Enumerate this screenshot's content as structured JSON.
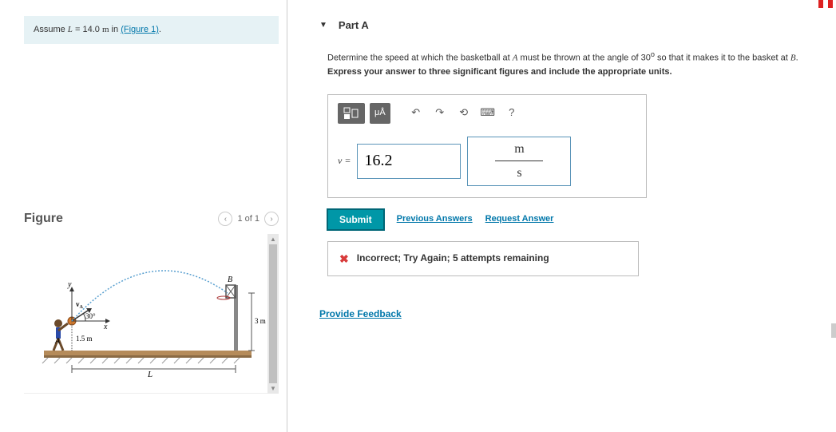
{
  "left": {
    "assume_prefix": "Assume ",
    "assume_var": "L",
    "assume_eq": " = 14.0 ",
    "assume_unit": "m",
    "assume_in": " in ",
    "figure_link": "(Figure 1)",
    "assume_period": "."
  },
  "figure": {
    "title": "Figure",
    "page_info": "1 of 1",
    "labels": {
      "angle": "30°",
      "x": "x",
      "y": "y",
      "height_left": "1.5 m",
      "height_right": "3 m",
      "L": "L",
      "A": "A",
      "B": "B",
      "vA": "vA"
    }
  },
  "part": {
    "header": "Part A",
    "q1_a": "Determine the speed at which the basketball at ",
    "q1_A": "A",
    "q1_b": " must be thrown at the angle of 30",
    "q1_deg": "o",
    "q1_c": " so that it makes it to the basket at ",
    "q1_B": "B",
    "q1_d": ".",
    "q2": "Express your answer to three significant figures and include the appropriate units."
  },
  "toolbar": {
    "templates_label": "▯▯",
    "mu_label": "μÅ",
    "undo": "↶",
    "redo": "↷",
    "reset": "⟲",
    "keyboard": "⌨",
    "help": "?"
  },
  "answer": {
    "var": "v",
    "equals": " = ",
    "value": "16.2",
    "unit_num": "m",
    "unit_den": "s"
  },
  "actions": {
    "submit": "Submit",
    "previous": "Previous Answers",
    "request": "Request Answer"
  },
  "feedback": {
    "text": "Incorrect; Try Again; 5 attempts remaining"
  },
  "provide_feedback": "Provide Feedback"
}
